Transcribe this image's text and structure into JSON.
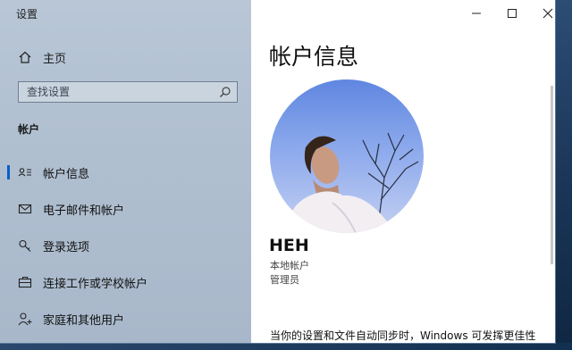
{
  "window": {
    "title": "设置"
  },
  "sidebar": {
    "home_label": "主页",
    "search": {
      "placeholder": "查找设置"
    },
    "section_title": "帐户",
    "items": [
      {
        "label": "帐户信息",
        "icon": "person-card-icon",
        "active": true
      },
      {
        "label": "电子邮件和帐户",
        "icon": "mail-icon"
      },
      {
        "label": "登录选项",
        "icon": "key-icon"
      },
      {
        "label": "连接工作或学校帐户",
        "icon": "briefcase-icon"
      },
      {
        "label": "家庭和其他用户",
        "icon": "person-add-icon"
      }
    ]
  },
  "main": {
    "title": "帐户信息",
    "user": {
      "name": "HEH",
      "account_type": "本地帐户",
      "role": "管理员"
    },
    "sync_text": "当你的设置和文件自动同步时，Windows 可发挥更佳性"
  },
  "colors": {
    "accent": "#0a5ec7",
    "sidebar_bg": "#b3c2d3"
  }
}
